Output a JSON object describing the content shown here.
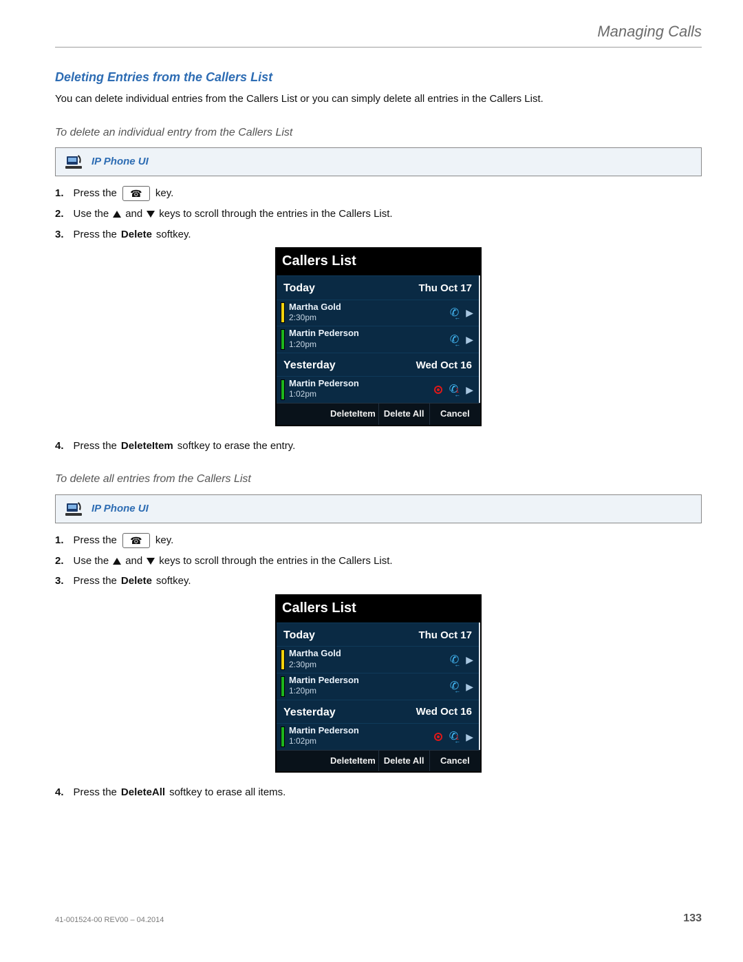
{
  "chapter_title": "Managing Calls",
  "section_title": "Deleting Entries from the Callers List",
  "intro_text": "You can delete individual entries from the Callers List or you can simply delete all entries in the Callers List.",
  "sub1_title": "To delete an individual entry from the Callers List",
  "sub2_title": "To delete all entries from the Callers List",
  "ip_ui_label": "IP Phone UI",
  "steps_a": {
    "s1_a": "Press the",
    "s1_b": "key.",
    "s2_a": "Use the",
    "s2_b": "and",
    "s2_c": "keys to scroll through the entries in the Callers List.",
    "s3_a": "Press the ",
    "s3_b": "Delete",
    "s3_c": " softkey.",
    "s4_a": "Press the ",
    "s4_b": "DeleteItem",
    "s4_c": " softkey to erase the entry."
  },
  "steps_b": {
    "s1_a": "Press the",
    "s1_b": "key.",
    "s2_a": "Use the",
    "s2_b": "and",
    "s2_c": "keys to scroll through the entries in the Callers List.",
    "s3_a": "Press the ",
    "s3_b": "Delete",
    "s3_c": " softkey.",
    "s4_a": "Press the ",
    "s4_b": "DeleteAll",
    "s4_c": " softkey to erase all items."
  },
  "screen": {
    "title": "Callers List",
    "today_label": "Today",
    "today_date": "Thu Oct 17",
    "yesterday_label": "Yesterday",
    "yesterday_date": "Wed Oct 16",
    "entries_today": [
      {
        "name": "Martha Gold",
        "time": "2:30pm",
        "bar": "yellow",
        "alert": false
      },
      {
        "name": "Martin Pederson",
        "time": "1:20pm",
        "bar": "green",
        "alert": false
      }
    ],
    "entries_yesterday": [
      {
        "name": "Martin Pederson",
        "time": "1:02pm",
        "bar": "green",
        "alert": true
      }
    ],
    "softkeys": [
      "",
      "DeleteItem",
      "Delete All",
      "Cancel"
    ]
  },
  "footer_doc": "41-001524-00 REV00 – 04.2014",
  "page_num": "133"
}
